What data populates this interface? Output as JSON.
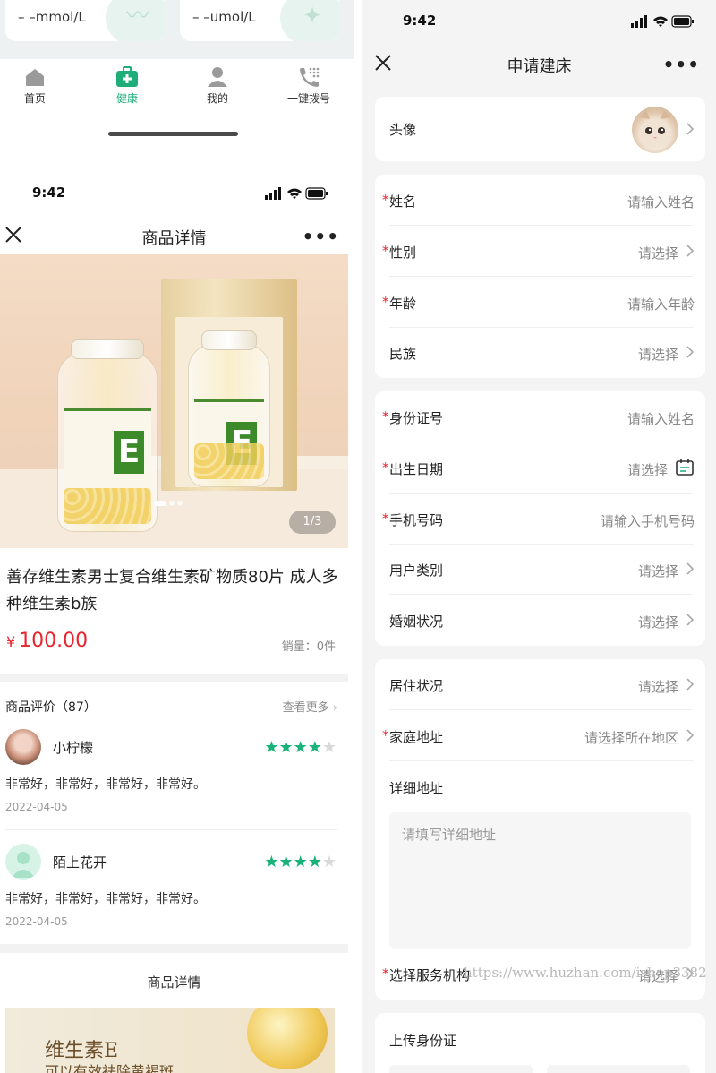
{
  "left": {
    "health_cards": [
      {
        "value": "– –mmol/L",
        "icon": "heartbeat-icon"
      },
      {
        "value": "– –umol/L",
        "icon": "sparkle-icon"
      }
    ],
    "tabbar": [
      {
        "label": "首页",
        "icon": "home-icon"
      },
      {
        "label": "健康",
        "icon": "medical-kit-icon",
        "active": true
      },
      {
        "label": "我的",
        "icon": "user-icon"
      },
      {
        "label": "一键拨号",
        "icon": "phone-dial-icon"
      }
    ],
    "status_time": "9:42",
    "nav_title": "商品详情",
    "pager": "1/3",
    "product_title": "善存维生素男士复合维生素矿物质80片 成人多种维生素b族",
    "price_currency": "¥",
    "price_value": "100.00",
    "sales": "销量：0件",
    "reviews_header": "商品评价（87）",
    "reviews_more": "查看更多",
    "reviews": [
      {
        "name": "小柠檬",
        "rating": 4,
        "text": "非常好，非常好，非常好，非常好。",
        "date": "2022-04-05"
      },
      {
        "name": "陌上花开",
        "rating": 4,
        "text": "非常好，非常好，非常好，非常好。",
        "date": "2022-04-05"
      }
    ],
    "detail_header": "商品详情",
    "detail_banner": {
      "line1": "维生素E",
      "line2": "可以有效祛除黄褐斑"
    }
  },
  "right": {
    "status_time": "9:42",
    "nav_title": "申请建床",
    "avatar_label": "头像",
    "groups": [
      [
        {
          "label": "姓名",
          "required": true,
          "value": "请输入姓名",
          "arrow": false
        },
        {
          "label": "性别",
          "required": true,
          "value": "请选择",
          "arrow": true
        },
        {
          "label": "年龄",
          "required": true,
          "value": "请输入年龄",
          "arrow": false
        },
        {
          "label": "民族",
          "required": false,
          "value": "请选择",
          "arrow": true
        }
      ],
      [
        {
          "label": "身份证号",
          "required": true,
          "value": "请输入姓名",
          "arrow": false
        },
        {
          "label": "出生日期",
          "required": true,
          "value": "请选择",
          "arrow": false,
          "icon": "calendar-icon"
        },
        {
          "label": "手机号码",
          "required": true,
          "value": "请输入手机号码",
          "arrow": false
        },
        {
          "label": "用户类别",
          "required": false,
          "value": "请选择",
          "arrow": true
        },
        {
          "label": "婚姻状况",
          "required": false,
          "value": "请选择",
          "arrow": true
        }
      ]
    ],
    "residence": {
      "label": "居住状况",
      "value": "请选择"
    },
    "address": {
      "label": "家庭地址",
      "value": "请选择所在地区"
    },
    "detail_address": {
      "label": "详细地址",
      "placeholder": "请填写详细地址"
    },
    "service_org": {
      "label": "选择服务机构",
      "value": "请选择"
    },
    "upload_title": "上传身份证",
    "watermark": "https://www.huzhan.com/ishop3382"
  },
  "colors": {
    "accent": "#1fae7a",
    "price": "#e8242c",
    "star": "#19b37a"
  }
}
